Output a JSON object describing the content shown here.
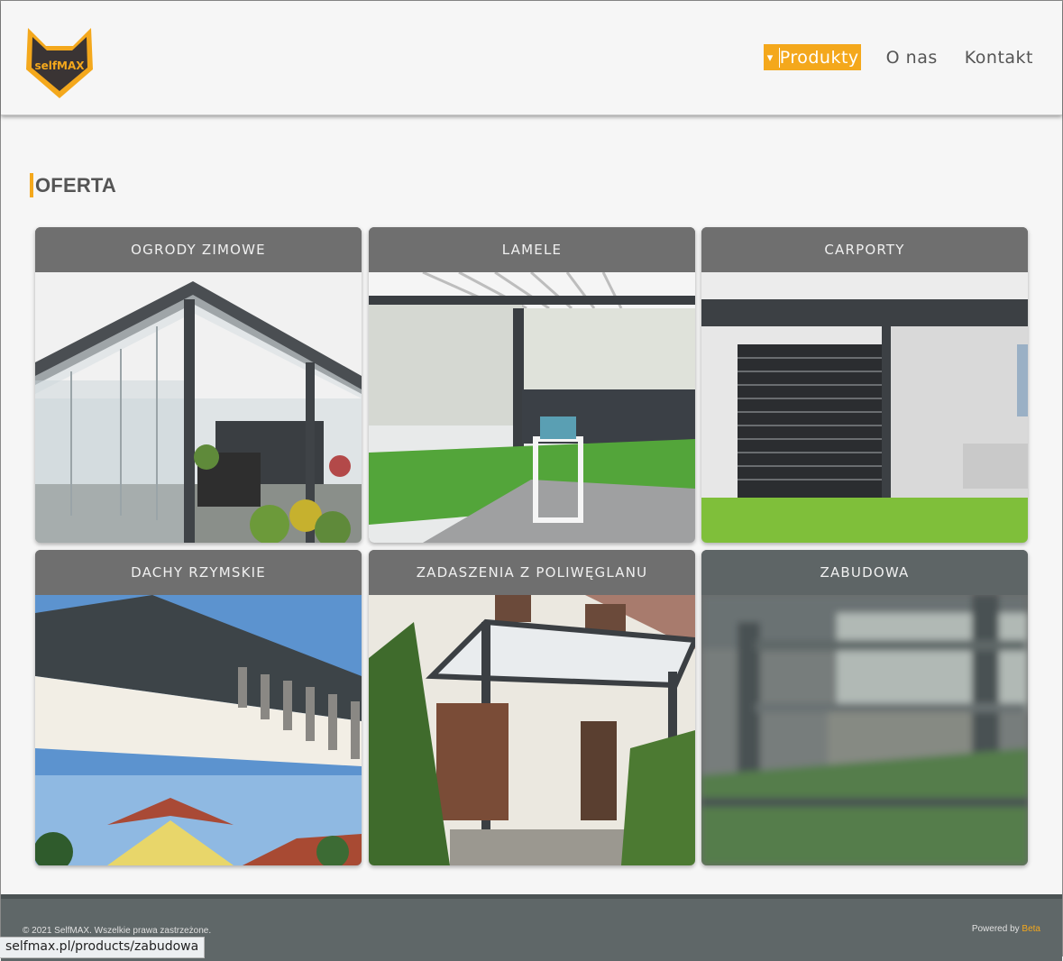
{
  "brand": {
    "logo_text": "selfMAX"
  },
  "nav": {
    "active_caret": "▾",
    "items": [
      {
        "label": "Produkty"
      },
      {
        "label": "O nas"
      },
      {
        "label": "Kontakt"
      }
    ]
  },
  "section": {
    "title": "OFERTA"
  },
  "cards": [
    {
      "title": "OGRODY ZIMOWE"
    },
    {
      "title": "LAMELE"
    },
    {
      "title": "CARPORTY"
    },
    {
      "title": "DACHY RZYMSKIE"
    },
    {
      "title": "ZADASZENIA Z POLIWĘGLANU"
    },
    {
      "title": "ZABUDOWA"
    }
  ],
  "footer": {
    "copyright": "© 2021 SelfMAX. Wszelkie prawa zastrzeżone.",
    "powered_prefix": "Powered by",
    "powered_link": "Beta"
  },
  "status_url": "selfmax.pl/products/zabudowa",
  "colors": {
    "accent": "#f4a81c",
    "header_bg": "#f6f6f6",
    "card_head": "#6f6f6f",
    "footer_bg": "#5f6768"
  }
}
